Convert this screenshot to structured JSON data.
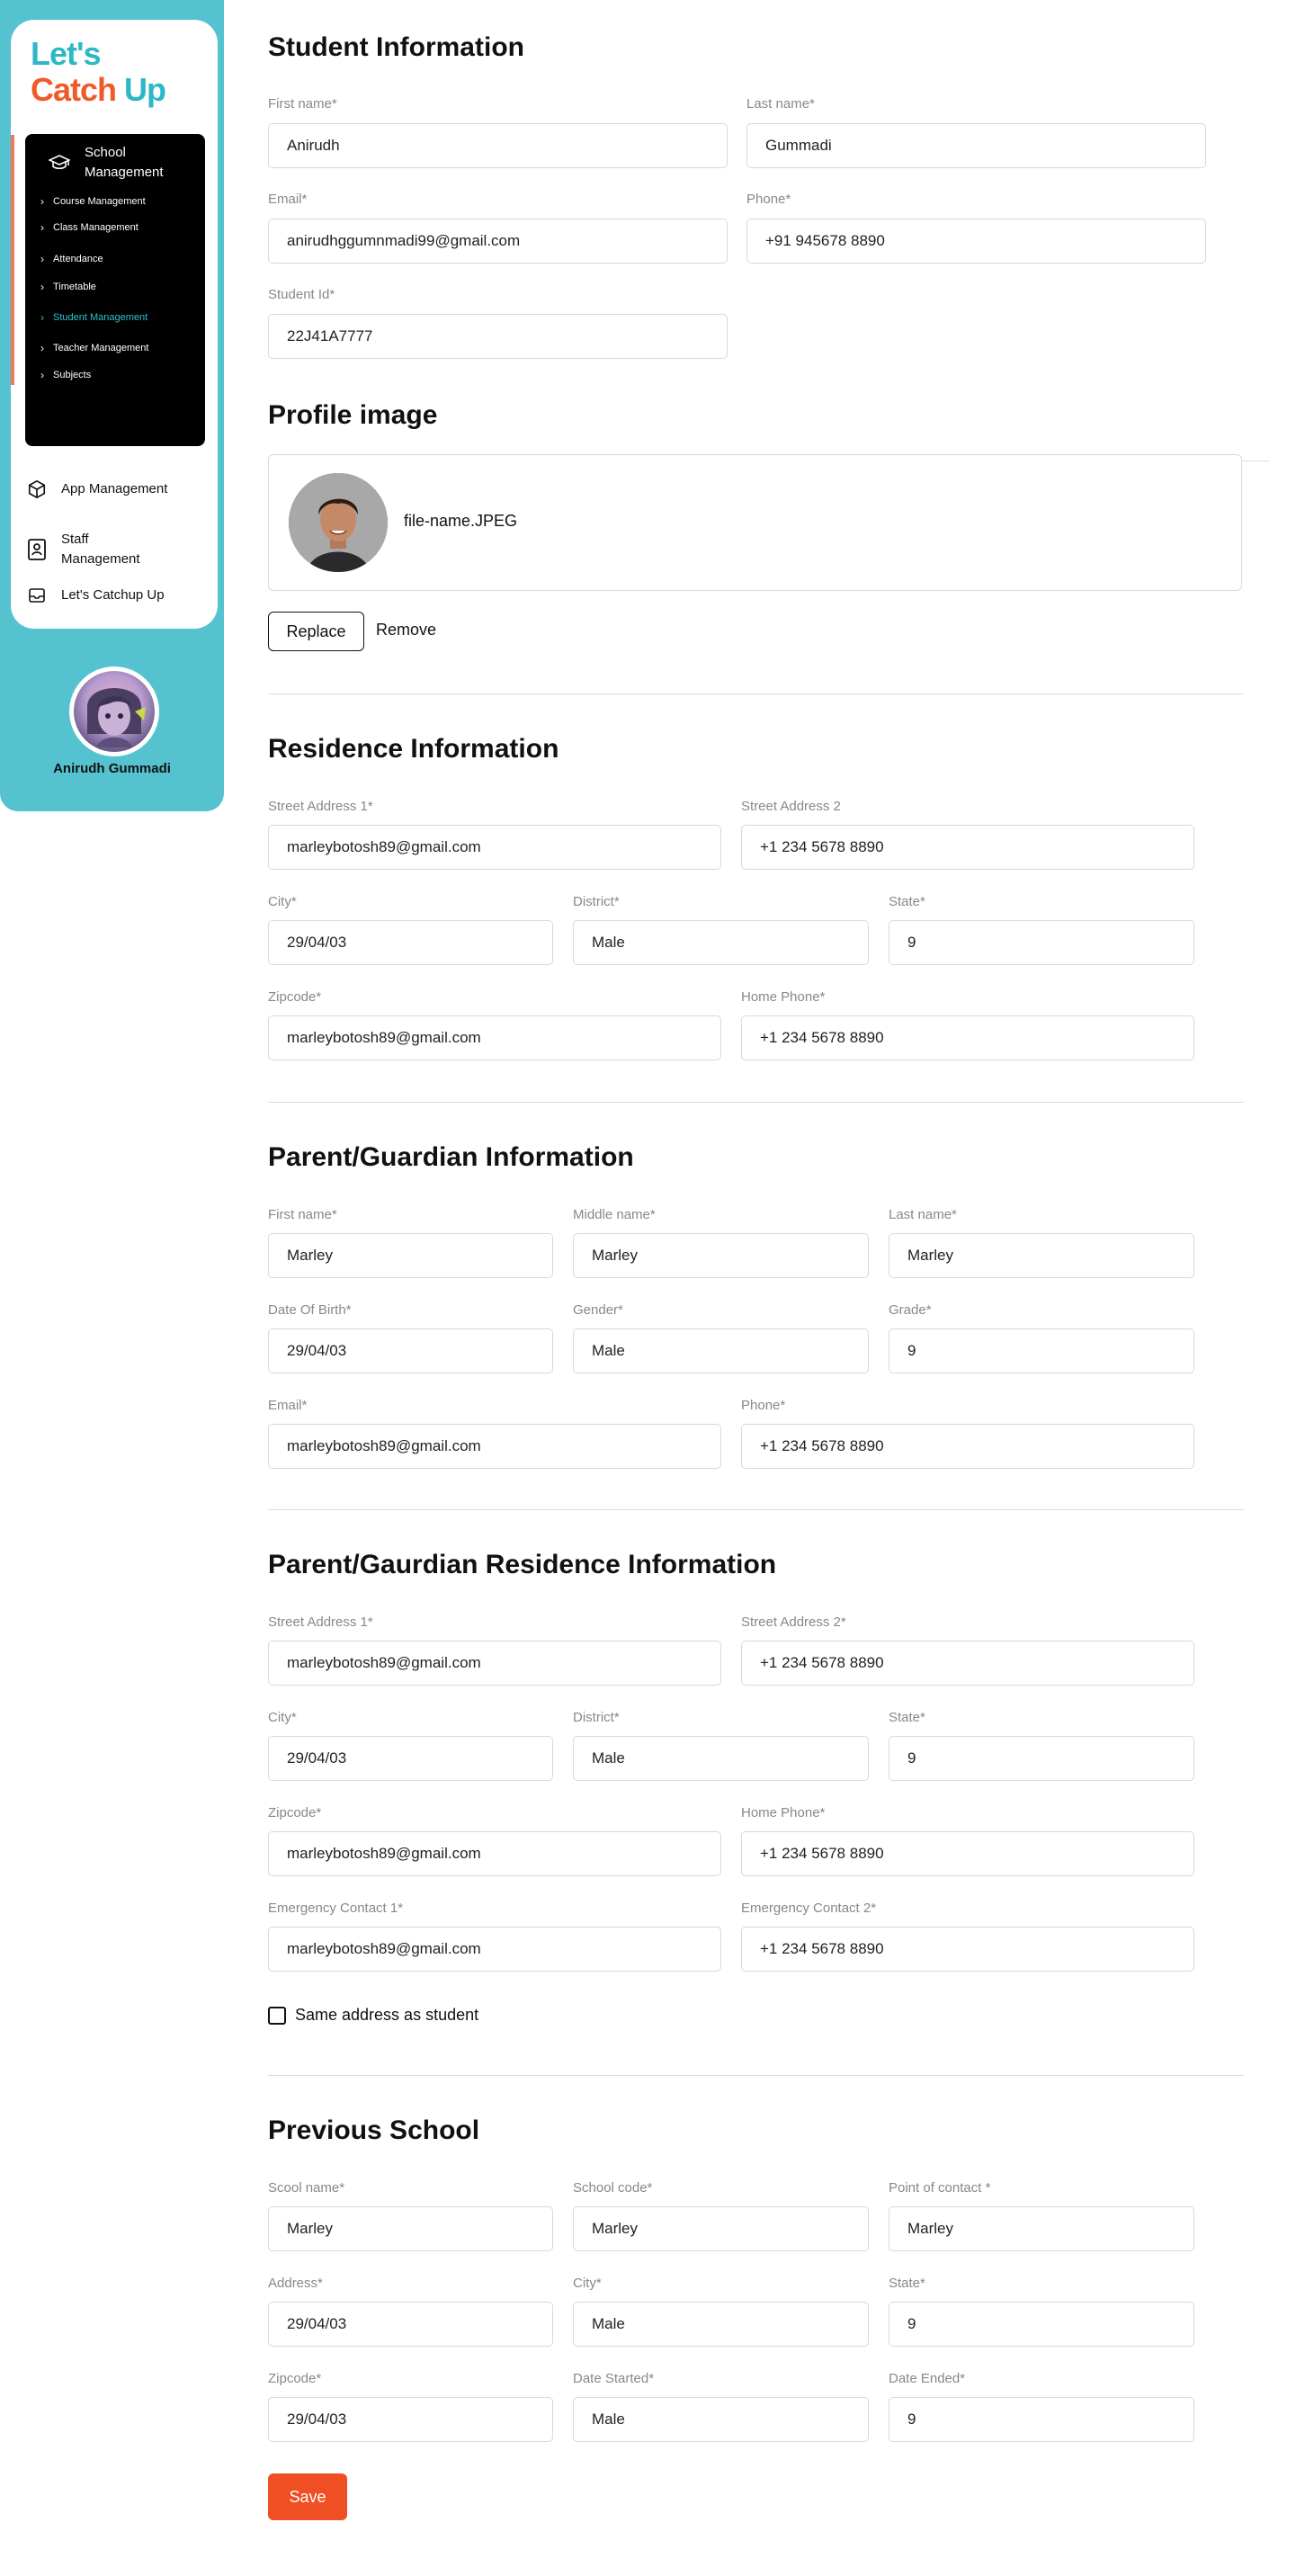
{
  "brand": {
    "line1": "Let's",
    "catch": "Catch",
    "up": "Up"
  },
  "sidebar": {
    "section_title": "School Management",
    "items": [
      {
        "label": "Course Management"
      },
      {
        "label": "Class Management"
      },
      {
        "label": "Attendance"
      },
      {
        "label": "Timetable"
      },
      {
        "label": "Student Management",
        "active": true
      },
      {
        "label": "Teacher Management"
      },
      {
        "label": "Subjects"
      }
    ],
    "bottom": [
      {
        "label": "App Management",
        "icon": "cube-icon"
      },
      {
        "label": "Staff Management",
        "icon": "contact-card-icon"
      },
      {
        "label": "Let's Catchup Up",
        "icon": "inbox-icon"
      }
    ],
    "user_name": "Anirudh Gummadi"
  },
  "student": {
    "title": "Student Information",
    "first_name_label": "First name*",
    "first_name": "Anirudh",
    "last_name_label": "Last name*",
    "last_name": "Gummadi",
    "email_label": "Email*",
    "email": "anirudhggumnmadi99@gmail.com",
    "phone_label": "Phone*",
    "phone": "+91 945678 8890",
    "id_label": "Student Id*",
    "id": "22J41A7777"
  },
  "profile": {
    "title": "Profile image",
    "file_name": "file-name.JPEG",
    "replace_label": "Replace",
    "remove_label": "Remove"
  },
  "residence": {
    "title": "Residence Information",
    "street1_label": "Street Address 1*",
    "street1": "marleybotosh89@gmail.com",
    "street2_label": "Street Address 2",
    "street2": "+1 234 5678 8890",
    "city_label": "City*",
    "city": "29/04/03",
    "district_label": "District*",
    "district": "Male",
    "state_label": "State*",
    "state": "9",
    "zip_label": "Zipcode*",
    "zip": "marleybotosh89@gmail.com",
    "home_phone_label": "Home Phone*",
    "home_phone": "+1 234 5678 8890"
  },
  "parent": {
    "title": "Parent/Guardian Information",
    "first_label": "First name*",
    "first": "Marley",
    "middle_label": "Middle name*",
    "middle": "Marley",
    "last_label": "Last name*",
    "last": "Marley",
    "dob_label": "Date Of Birth*",
    "dob": "29/04/03",
    "gender_label": "Gender*",
    "gender": "Male",
    "grade_label": "Grade*",
    "grade": "9",
    "email_label": "Email*",
    "email": "marleybotosh89@gmail.com",
    "phone_label": "Phone*",
    "phone": "+1 234 5678 8890"
  },
  "parent_res": {
    "title": "Parent/Gaurdian Residence Information",
    "street1_label": "Street Address 1*",
    "street1": "marleybotosh89@gmail.com",
    "street2_label": "Street Address 2*",
    "street2": "+1 234 5678 8890",
    "city_label": "City*",
    "city": "29/04/03",
    "district_label": "District*",
    "district": "Male",
    "state_label": "State*",
    "state": "9",
    "zip_label": "Zipcode*",
    "zip": "marleybotosh89@gmail.com",
    "home_phone_label": "Home Phone*",
    "home_phone": "+1 234 5678 8890",
    "em1_label": "Emergency Contact 1*",
    "em1": "marleybotosh89@gmail.com",
    "em2_label": "Emergency Contact 2*",
    "em2": "+1 234 5678 8890",
    "same_address_label": "Same address as student"
  },
  "prev_school": {
    "title": "Previous School",
    "name_label": "Scool name*",
    "name": "Marley",
    "code_label": "School code*",
    "code": "Marley",
    "poc_label": "Point of contact *",
    "poc": "Marley",
    "address_label": "Address*",
    "address": "29/04/03",
    "city_label": "City*",
    "city": "Male",
    "state_label": "State*",
    "state": "9",
    "zip_label": "Zipcode*",
    "zip": "29/04/03",
    "started_label": "Date Started*",
    "started": "Male",
    "ended_label": "Date Ended*",
    "ended": "9"
  },
  "save_label": "Save"
}
